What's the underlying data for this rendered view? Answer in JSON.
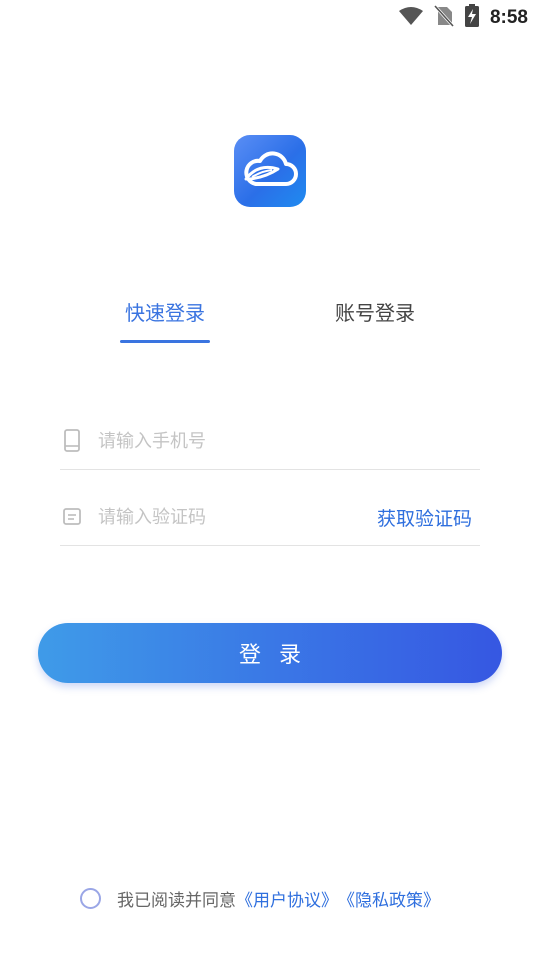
{
  "status_bar": {
    "time": "8:58",
    "icons": [
      "wifi-icon",
      "no-sim-icon",
      "battery-charging-icon"
    ]
  },
  "logo": {
    "icon": "cloud-leaf-icon",
    "colors": {
      "start": "#5a8ef5",
      "end": "#1f8bf0"
    }
  },
  "tabs": [
    {
      "label": "快速登录",
      "active": true
    },
    {
      "label": "账号登录",
      "active": false
    }
  ],
  "form": {
    "phone": {
      "icon": "phone-icon",
      "placeholder": "请输入手机号",
      "value": ""
    },
    "code": {
      "icon": "message-icon",
      "placeholder": "请输入验证码",
      "value": "",
      "action_label": "获取验证码"
    }
  },
  "login_button": {
    "label": "登录"
  },
  "agreement": {
    "checked": false,
    "prefix": "我已阅读并同意",
    "user_agreement": "《用户协议》",
    "privacy_policy": "《隐私政策》"
  },
  "theme": {
    "accent": "#3a74e0",
    "link": "#2f6fde"
  }
}
